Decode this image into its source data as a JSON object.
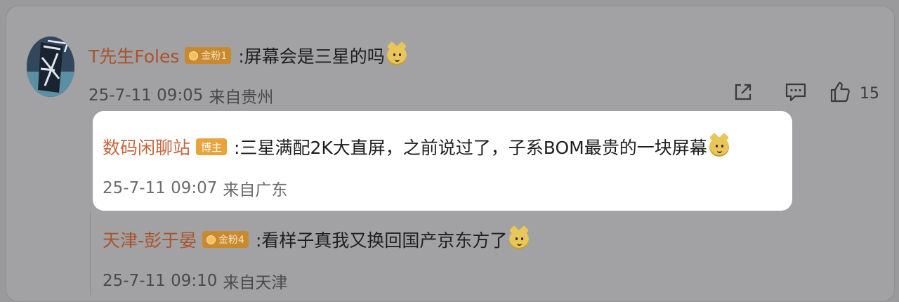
{
  "comment": {
    "username": "T先生Foles",
    "badge": "金粉1",
    "text": ":屏幕会是三星的吗",
    "time": "25-7-11 09:05",
    "location": "来自贵州",
    "like_count": "15"
  },
  "replies": [
    {
      "username": "数码闲聊站",
      "badge": "博主",
      "text": ":三星满配2K大直屏，之前说过了，子系BOM最贵的一块屏幕",
      "time": "25-7-11 09:07",
      "location": "来自广东"
    },
    {
      "username": "天津-彭于晏",
      "badge": "金粉4",
      "text": ":看样子真我又换回国产京东方了",
      "time": "25-7-11 09:10",
      "location": "来自天津"
    }
  ],
  "icons": [
    "share-icon",
    "comment-icon",
    "like-icon",
    "face-emoji-icon"
  ],
  "colors": {
    "username": "#a8532c",
    "badge": "#c98a2f",
    "blogger_badge": "#e8a33a"
  }
}
